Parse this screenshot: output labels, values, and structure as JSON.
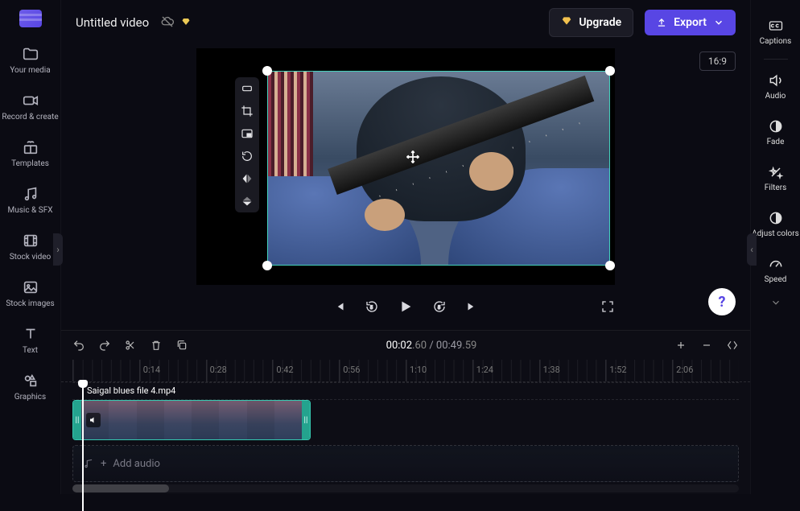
{
  "titlebar": {
    "video_title": "Untitled video"
  },
  "topbar": {
    "upgrade_label": "Upgrade",
    "export_label": "Export"
  },
  "ratio": {
    "label": "16:9"
  },
  "left_sidebar": {
    "items": [
      {
        "label": "Your media"
      },
      {
        "label": "Record & create"
      },
      {
        "label": "Templates"
      },
      {
        "label": "Music & SFX"
      },
      {
        "label": "Stock video"
      },
      {
        "label": "Stock images"
      },
      {
        "label": "Text"
      },
      {
        "label": "Graphics"
      }
    ]
  },
  "right_sidebar": {
    "items": [
      {
        "label": "Captions"
      },
      {
        "label": "Audio"
      },
      {
        "label": "Fade"
      },
      {
        "label": "Filters"
      },
      {
        "label": "Adjust colors"
      },
      {
        "label": "Speed"
      }
    ]
  },
  "playback": {
    "current_whole": "00:02",
    "current_frac": ".60",
    "duration_whole": "00:49",
    "duration_frac": ".59"
  },
  "ruler": {
    "marks": [
      "",
      "0:14",
      "0:28",
      "0:42",
      "0:56",
      "1:10",
      "1:24",
      "1:38",
      "1:52",
      "2:06"
    ]
  },
  "clip": {
    "filename": "Saigal blues file 4.mp4"
  },
  "audio_row": {
    "label": "Add audio"
  }
}
